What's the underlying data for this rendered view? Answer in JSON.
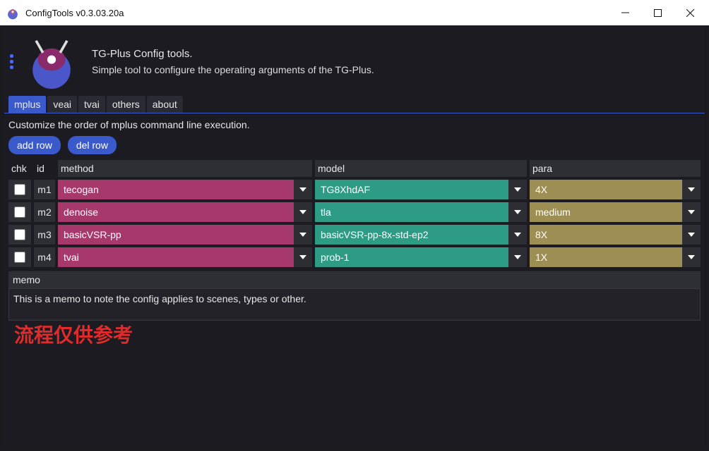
{
  "window": {
    "title": "ConfigTools v0.3.03.20a"
  },
  "header": {
    "title": "TG-Plus Config tools.",
    "subtitle": "Simple tool to configure the operating arguments of the TG-Plus."
  },
  "tabs": [
    "mplus",
    "veai",
    "tvai",
    "others",
    "about"
  ],
  "activeTab": "mplus",
  "subhead": "Customize the order of mplus command line execution.",
  "buttons": {
    "add": "add row",
    "del": "del row"
  },
  "columns": {
    "chk": "chk",
    "id": "id",
    "method": "method",
    "model": "model",
    "para": "para"
  },
  "rows": [
    {
      "id": "m1",
      "method": "tecogan",
      "model": "TG8XhdAF",
      "para": "4X"
    },
    {
      "id": "m2",
      "method": "denoise",
      "model": "tla",
      "para": "medium"
    },
    {
      "id": "m3",
      "method": "basicVSR-pp",
      "model": "basicVSR-pp-8x-std-ep2",
      "para": "8X"
    },
    {
      "id": "m4",
      "method": "tvai",
      "model": "prob-1",
      "para": "1X"
    }
  ],
  "memo": {
    "label": "memo",
    "text": "This is a memo to note the config applies to scenes, types or other."
  },
  "watermark": "流程仅供参考"
}
